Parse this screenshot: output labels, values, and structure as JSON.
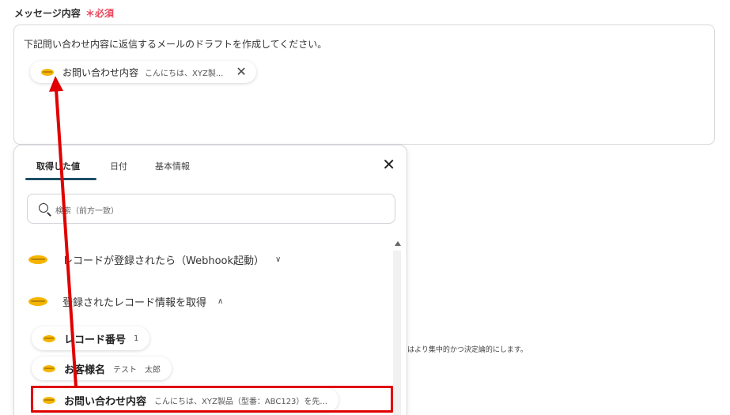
{
  "field": {
    "label": "メッセージ内容",
    "required_mark": "＊必須",
    "prompt_text": "下記問い合わせ内容に返信するメールのドラフトを作成してください。",
    "inserted_chip": {
      "name": "お問い合わせ内容",
      "value": "こんにちは、XYZ製...",
      "close": "✕"
    }
  },
  "panel": {
    "tabs": [
      {
        "label": "取得した値",
        "active": true
      },
      {
        "label": "日付",
        "active": false
      },
      {
        "label": "基本情報",
        "active": false
      }
    ],
    "close": "✕",
    "search_placeholder": "検索（前方一致）",
    "sections": [
      {
        "title": "レコードが登録されたら（Webhook起動）",
        "chevron": "∨"
      },
      {
        "title": "登録されたレコード情報を取得",
        "chevron": "∧"
      }
    ],
    "items": [
      {
        "name": "レコード番号",
        "value": "1"
      },
      {
        "name": "お客様名",
        "value": "テスト　太郎"
      },
      {
        "name": "お問い合わせ内容",
        "value": "こんにちは、XYZ製品（型番：ABC123）を先..."
      }
    ]
  },
  "background_text": "はより集中的かつ決定論的にします。",
  "colors": {
    "accent": "#1f4f66",
    "required": "#e8455b",
    "kintone": "#f6b400",
    "annotation": "#e00000"
  }
}
